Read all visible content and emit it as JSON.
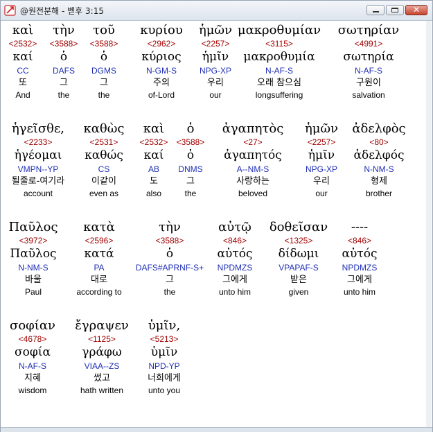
{
  "window": {
    "title": "@원전분해 - 벧후 3:15",
    "buttons": {
      "minimize": "minimize",
      "maximize": "maximize",
      "close": "✕"
    }
  },
  "rows": [
    [
      {
        "greek": "καὶ",
        "strong": "<2532>",
        "lemma": "καί",
        "parse": "CC",
        "korean": "또",
        "english": "And"
      },
      {
        "greek": "τὴν",
        "strong": "<3588>",
        "lemma": "ὁ",
        "parse": "DAFS",
        "korean": "그",
        "english": "the"
      },
      {
        "greek": "τοῦ",
        "strong": "<3588>",
        "lemma": "ὁ",
        "parse": "DGMS",
        "korean": "그",
        "english": "the"
      },
      {
        "greek": "κυρίου",
        "strong": "<2962>",
        "lemma": "κύριος",
        "parse": "N-GM-S",
        "korean": "주의",
        "english": "of-Lord"
      },
      {
        "greek": "ἡμῶν",
        "strong": "<2257>",
        "lemma": "ἡμῖν",
        "parse": "NPG-XP",
        "korean": "우리",
        "english": "our"
      },
      {
        "greek": "μακροθυμίαν",
        "strong": "<3115>",
        "lemma": "μακροθυμία",
        "parse": "N-AF-S",
        "korean": "오래 참으심",
        "english": "longsuffering"
      },
      {
        "greek": "σωτηρίαν",
        "strong": "<4991>",
        "lemma": "σωτηρία",
        "parse": "N-AF-S",
        "korean": "구원이",
        "english": "salvation"
      }
    ],
    [
      {
        "greek": "ἡγεῖσθε,",
        "strong": "<2233>",
        "lemma": "ἡγέομαι",
        "parse": "VMPN--YP",
        "korean": "될줄로-여기라",
        "english": "account"
      },
      {
        "greek": "καθὼς",
        "strong": "<2531>",
        "lemma": "καθώς",
        "parse": "CS",
        "korean": "이같이",
        "english": "even as"
      },
      {
        "greek": "καὶ",
        "strong": "<2532>",
        "lemma": "καί",
        "parse": "AB",
        "korean": "도",
        "english": "also"
      },
      {
        "greek": "ὁ",
        "strong": "<3588>",
        "lemma": "ὁ",
        "parse": "DNMS",
        "korean": "그",
        "english": "the"
      },
      {
        "greek": "ἀγαπητὸς",
        "strong": "<27>",
        "lemma": "ἀγαπητός",
        "parse": "A--NM-S",
        "korean": "사랑하는",
        "english": "beloved"
      },
      {
        "greek": "ἡμῶν",
        "strong": "<2257>",
        "lemma": "ἡμῖν",
        "parse": "NPG-XP",
        "korean": "우리",
        "english": "our"
      },
      {
        "greek": "ἀδελφὸς",
        "strong": "<80>",
        "lemma": "ἀδελφός",
        "parse": "N-NM-S",
        "korean": "형제",
        "english": "brother"
      }
    ],
    [
      {
        "greek": "Παῦλος",
        "strong": "<3972>",
        "lemma": "Παῦλος",
        "parse": "N-NM-S",
        "korean": "바울",
        "english": "Paul"
      },
      {
        "greek": "κατὰ",
        "strong": "<2596>",
        "lemma": "κατά",
        "parse": "PA",
        "korean": "대로",
        "english": "according to"
      },
      {
        "greek": "τὴν",
        "strong": "<3588>",
        "lemma": "ὁ",
        "parse": "DAFS#APRNF-S+",
        "korean": "그",
        "english": "the"
      },
      {
        "greek": "αὐτῷ",
        "strong": "<846>",
        "lemma": "αὐτός",
        "parse": "NPDMZS",
        "korean": "그에게",
        "english": "unto him"
      },
      {
        "greek": "δοθεῖσαν",
        "strong": "<1325>",
        "lemma": "δίδωμι",
        "parse": "VPAPAF-S",
        "korean": "받은",
        "english": "given"
      },
      {
        "greek": "----",
        "strong": "<846>",
        "lemma": "αὐτός",
        "parse": "NPDMZS",
        "korean": "그에게",
        "english": "unto him"
      }
    ],
    [
      {
        "greek": "σοφίαν",
        "strong": "<4678>",
        "lemma": "σοφία",
        "parse": "N-AF-S",
        "korean": "지혜",
        "english": "wisdom"
      },
      {
        "greek": "ἔγραψεν",
        "strong": "<1125>",
        "lemma": "γράφω",
        "parse": "VIAA--ZS",
        "korean": "썼고",
        "english": "hath written"
      },
      {
        "greek": "ὑμῖν,",
        "strong": "<5213>",
        "lemma": "ὑμῖν",
        "parse": "NPD-YP",
        "korean": "너희에게",
        "english": "unto you"
      }
    ]
  ]
}
